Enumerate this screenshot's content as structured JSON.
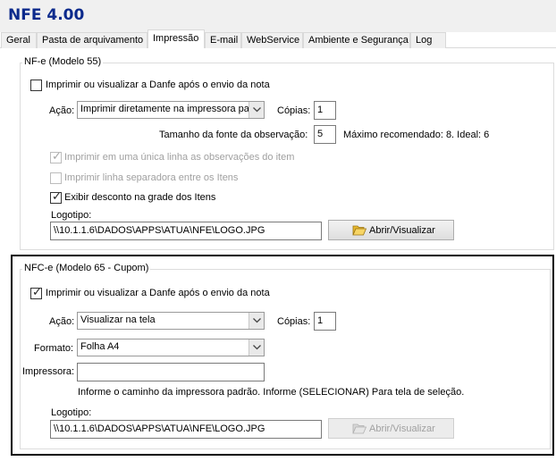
{
  "app": {
    "title": "NFE 4.00"
  },
  "tabs": [
    {
      "label": "Geral"
    },
    {
      "label": "Pasta de arquivamento"
    },
    {
      "label": "Impressão"
    },
    {
      "label": "E-mail"
    },
    {
      "label": "WebService"
    },
    {
      "label": "Ambiente e Segurança"
    },
    {
      "label": "Log"
    }
  ],
  "active_tab": "Impressão",
  "nfe": {
    "legend": "NF-e (Modelo 55)",
    "print_after_send": {
      "label": "Imprimir ou visualizar a Danfe após o envio da nota",
      "checked": false
    },
    "acao": {
      "label": "Ação:",
      "value": "Imprimir diretamente na impressora padrão"
    },
    "copias": {
      "label": "Cópias:",
      "value": "1"
    },
    "font_size": {
      "label": "Tamanho da fonte da observação:",
      "value": "5",
      "hint": "Máximo recomendado: 8. Ideal: 6"
    },
    "single_line": {
      "label": "Imprimir em uma única linha as observações do item",
      "checked": true,
      "enabled": false
    },
    "separator_line": {
      "label": "Imprimir linha separadora entre os Itens",
      "checked": false,
      "enabled": false
    },
    "show_discount": {
      "label": "Exibir desconto na grade dos Itens",
      "checked": true
    },
    "logotipo": {
      "label": "Logotipo:",
      "value": "\\\\10.1.1.6\\DADOS\\APPS\\ATUA\\NFE\\LOGO.JPG"
    },
    "open_button": {
      "label": "Abrir/Visualizar",
      "enabled": true
    }
  },
  "nfce": {
    "legend": "NFC-e (Modelo 65 - Cupom)",
    "print_after_send": {
      "label": "Imprimir ou visualizar a Danfe após o envio da nota",
      "checked": true
    },
    "acao": {
      "label": "Ação:",
      "value": "Visualizar na tela"
    },
    "copias": {
      "label": "Cópias:",
      "value": "1"
    },
    "formato": {
      "label": "Formato:",
      "value": "Folha A4"
    },
    "impressora": {
      "label": "Impressora:",
      "value": "",
      "hint": "Informe o caminho da impressora padrão.  Informe (SELECIONAR) Para tela de seleção."
    },
    "logotipo": {
      "label": "Logotipo:",
      "value": "\\\\10.1.1.6\\DADOS\\APPS\\ATUA\\NFE\\LOGO.JPG"
    },
    "open_button": {
      "label": "Abrir/Visualizar",
      "enabled": false
    }
  },
  "icons": {
    "dropdown": "chevron-down-icon",
    "folder": "folder-open-icon",
    "check": "check-icon"
  }
}
